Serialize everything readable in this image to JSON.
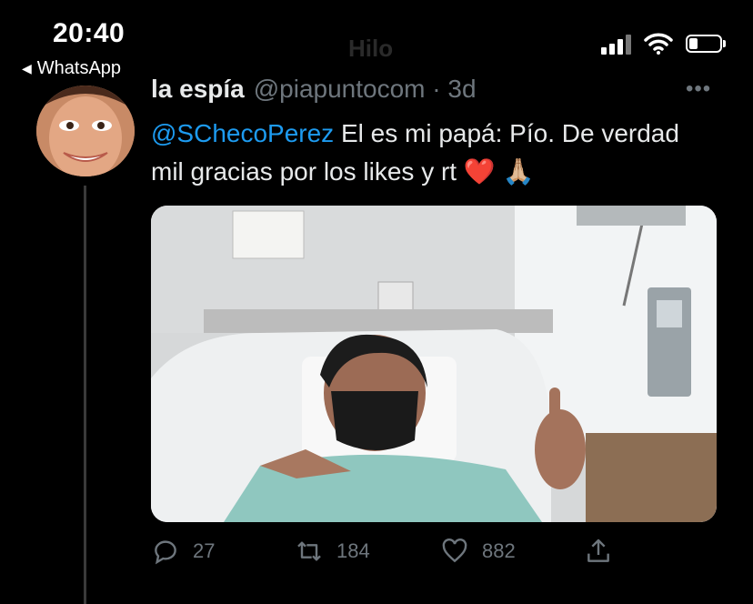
{
  "status": {
    "time": "20:40",
    "back_app": "WhatsApp",
    "faded_title": "Hilo",
    "battery_level": 0.2
  },
  "tweet": {
    "display_name": "la espía",
    "handle_line": "@piapuntocom · 3d",
    "mention": "@SChecoPerez",
    "text_after_mention": " El es mi papá: Pío. De verdad mil gracias por los likes y rt",
    "emoji": "❤️ 🙏🏼",
    "more": "•••",
    "actions": {
      "replies": "27",
      "retweets": "184",
      "likes": "882"
    }
  },
  "colors": {
    "background": "#000000",
    "text": "#e7e9ea",
    "muted": "#6e767d",
    "link": "#1d9bf0"
  },
  "icons": [
    "back-arrow-icon",
    "signal-icon",
    "wifi-icon",
    "battery-icon",
    "more-icon",
    "reply-icon",
    "retweet-icon",
    "like-icon",
    "share-icon"
  ]
}
